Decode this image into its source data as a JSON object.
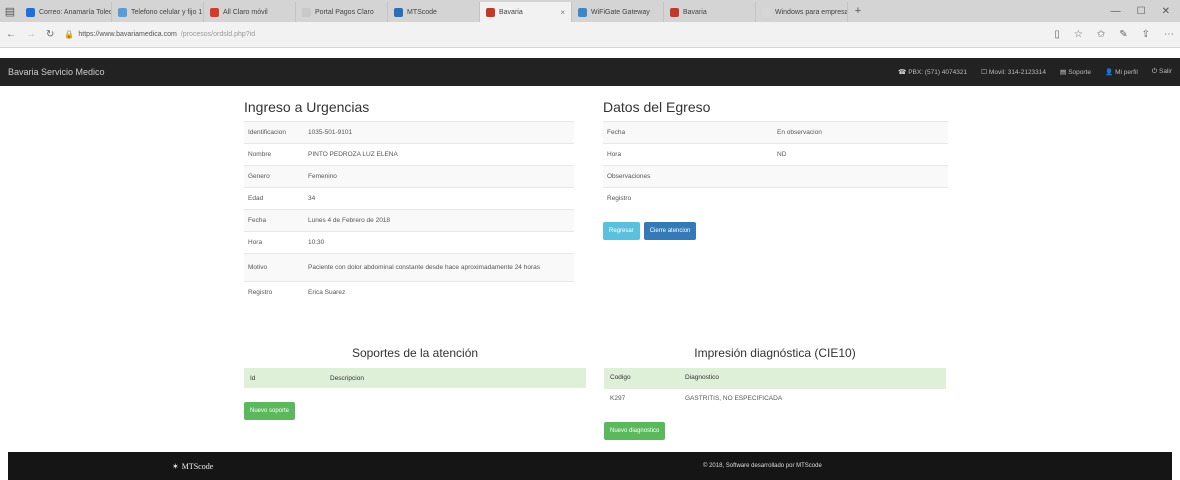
{
  "browser": {
    "tabs": [
      {
        "label": "Correo: Anamaría Toledo - Outlook",
        "color": "#1e6fd9"
      },
      {
        "label": "Telefono celular y fijo 1",
        "color": "#5c9bd6"
      },
      {
        "label": "All Claro móvil",
        "color": "#d43b2f"
      },
      {
        "label": "Portal Pagos Claro",
        "color": "#c9c9c9"
      },
      {
        "label": "MTScode",
        "color": "#2a6fb5"
      },
      {
        "label": "Bavaria",
        "color": "#c0392b",
        "active": true
      },
      {
        "label": "WiFiGate Gateway",
        "color": "#3b88c4"
      },
      {
        "label": "Bavaria",
        "color": "#c0392b"
      },
      {
        "label": "Windows para empresas",
        "color": "#d6d6d6"
      }
    ],
    "url_host": "https://www.bavariamedica.com",
    "url_path": "/procesos/ordsld.php?id",
    "window_controls": [
      "—",
      "☐",
      "✕"
    ]
  },
  "navbar": {
    "brand": "Bavaria Servicio Medico",
    "links": [
      {
        "icon": "☎",
        "label": "PBX: (571) 4074321"
      },
      {
        "icon": "☐",
        "label": "Movil: 314-2123314"
      },
      {
        "icon": "▤",
        "label": "Soporte"
      },
      {
        "icon": "👤",
        "label": "Mi perfil"
      },
      {
        "icon": "⏻",
        "label": "Salir"
      }
    ]
  },
  "ingreso": {
    "title": "Ingreso a Urgencias",
    "rows": [
      {
        "k": "Identificacion",
        "v": "1035-501-9101"
      },
      {
        "k": "Nombre",
        "v": "PINTO PEDROZA LUZ ELENA"
      },
      {
        "k": "Genero",
        "v": "Femenino"
      },
      {
        "k": "Edad",
        "v": "34"
      },
      {
        "k": "Fecha",
        "v": "Lunes 4 de Febrero de 2018"
      },
      {
        "k": "Hora",
        "v": "10:30"
      },
      {
        "k": "Motivo",
        "v": "Paciente con dolor abdominal constante desde hace aproximadamente 24 horas"
      },
      {
        "k": "Registro",
        "v": "Erica Suarez"
      }
    ]
  },
  "egreso": {
    "title": "Datos del Egreso",
    "rows": [
      {
        "k": "Fecha",
        "v": "En observacion"
      },
      {
        "k": "Hora",
        "v": "ND"
      },
      {
        "k": "Observaciones",
        "v": ""
      },
      {
        "k": "Registro",
        "v": ""
      }
    ],
    "btn_regresar": "Regresar",
    "btn_cierre": "Cierre atencion"
  },
  "soportes": {
    "title": "Soportes de la atención",
    "columns": [
      "Id",
      "Descripcion"
    ],
    "btn_nuevo": "Nuevo soporte"
  },
  "impresion": {
    "title": "Impresión diagnóstica (CIE10)",
    "columns": [
      "Codigo",
      "Diagnostico"
    ],
    "rows": [
      {
        "codigo": "K297",
        "diagnostico": "GASTRITIS, NO ESPECIFICADA"
      }
    ],
    "btn_nuevo": "Nuevo diagnostico"
  },
  "footer": {
    "logo": "MTScode",
    "copyright": "© 2018, Software desarrollado por MTScode"
  }
}
